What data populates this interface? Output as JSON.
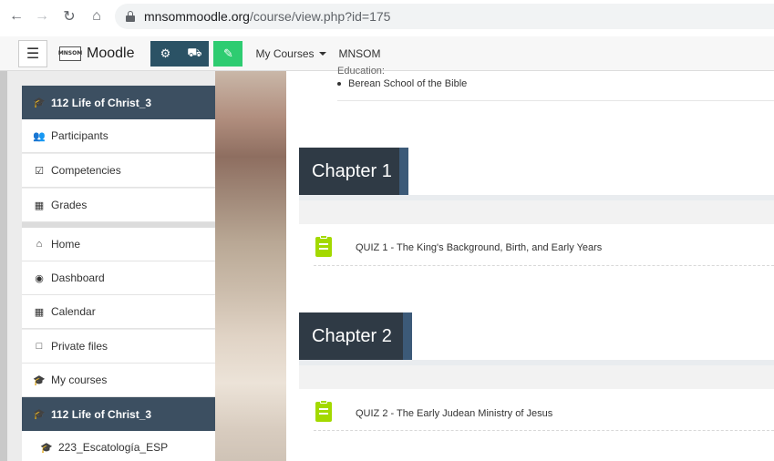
{
  "browser": {
    "url_host": "mnsommoodle.org",
    "url_path": "/course/view.php?id=175"
  },
  "navbar": {
    "brand": "Moodle",
    "logo_text": "MNSOM",
    "my_courses": "My Courses",
    "site": "MNSOM"
  },
  "drawer": {
    "course_header": "112 Life of Christ_3",
    "course_items": [
      {
        "label": "Participants",
        "icon": "users-icon"
      },
      {
        "label": "Competencies",
        "icon": "check-square-icon"
      },
      {
        "label": "Grades",
        "icon": "table-icon"
      }
    ],
    "site_items": [
      {
        "label": "Home",
        "icon": "home-icon"
      },
      {
        "label": "Dashboard",
        "icon": "dashboard-icon"
      },
      {
        "label": "Calendar",
        "icon": "calendar-icon"
      },
      {
        "label": "Private files",
        "icon": "file-icon"
      },
      {
        "label": "My courses",
        "icon": "graduation-cap-icon"
      }
    ],
    "current_course": "112 Life of Christ_3",
    "other_course": "223_Escatología_ESP"
  },
  "main": {
    "cut_text": "Education:",
    "bullet": "Berean School of the Bible",
    "chapters": [
      {
        "title": "Chapter 1",
        "quiz": "QUIZ 1 - The King's Background, Birth, and Early Years"
      },
      {
        "title": "Chapter 2",
        "quiz": "QUIZ 2 - The Early Judean Ministry of Jesus"
      }
    ]
  },
  "colors": {
    "drawer_active": "#3c4f61",
    "quiz_icon": "#a3d900",
    "chapter_tab": "#2f3a45",
    "tool_blue": "#2b5265",
    "tool_green": "#2ecc71"
  }
}
